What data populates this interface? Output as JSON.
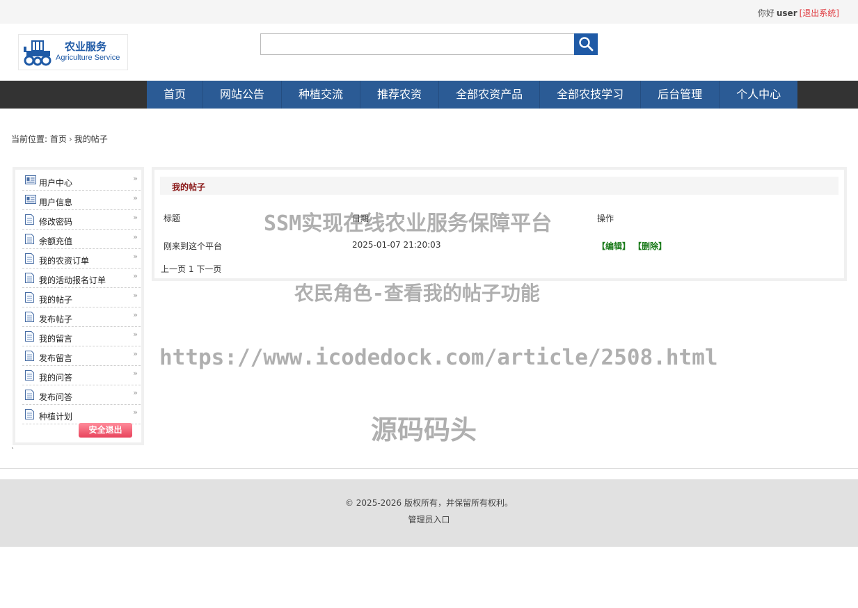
{
  "topbar": {
    "hello": "你好",
    "user": "user",
    "logout": "[退出系统]"
  },
  "logo": {
    "cn": "农业服务",
    "en": "Agriculture Service"
  },
  "search": {
    "placeholder": ""
  },
  "nav": [
    "首页",
    "网站公告",
    "种植交流",
    "推荐农资",
    "全部农资产品",
    "全部农技学习",
    "后台管理",
    "个人中心"
  ],
  "breadcrumb": {
    "prefix": "当前位置:",
    "home": "首页",
    "current": "我的帖子"
  },
  "sidebar": {
    "items": [
      {
        "label": "用户中心",
        "icon": "user-card-icon"
      },
      {
        "label": "用户信息",
        "icon": "user-card-icon"
      },
      {
        "label": "修改密码",
        "icon": "document-icon"
      },
      {
        "label": "余额充值",
        "icon": "document-icon"
      },
      {
        "label": "我的农资订单",
        "icon": "document-icon"
      },
      {
        "label": "我的活动报名订单",
        "icon": "document-icon"
      },
      {
        "label": "我的帖子",
        "icon": "document-icon"
      },
      {
        "label": "发布帖子",
        "icon": "document-icon"
      },
      {
        "label": "我的留言",
        "icon": "document-icon"
      },
      {
        "label": "发布留言",
        "icon": "document-icon"
      },
      {
        "label": "我的问答",
        "icon": "document-icon"
      },
      {
        "label": "发布问答",
        "icon": "document-icon"
      },
      {
        "label": "种植计划",
        "icon": "document-icon"
      }
    ],
    "exit": "安全退出"
  },
  "main": {
    "heading": "我的帖子",
    "columns": [
      "标题",
      "日期",
      "操作"
    ],
    "rows": [
      {
        "title": "刚来到这个平台",
        "date": "2025-01-07 21:20:03",
        "edit": "【编辑】",
        "delete": "【删除】"
      }
    ],
    "pager": {
      "prev": "上一页",
      "page": "1",
      "next": "下一页"
    }
  },
  "watermark": {
    "title": "SSM实现在线农业服务保障平台",
    "subtitle": "农民角色-查看我的帖子功能",
    "url": "https://www.icodedock.com/article/2508.html",
    "brand": "源码码头"
  },
  "stray_mark": "`",
  "footer": {
    "copyright": "© 2025-2026 版权所有，并保留所有权利。",
    "admin": "管理员入口"
  },
  "colors": {
    "nav_blue": "#2b5b95",
    "navbar_dark": "#333333",
    "logout_red": "#e0393e",
    "action_green": "#1a7a1a",
    "heading_red": "#8b1a1a"
  }
}
